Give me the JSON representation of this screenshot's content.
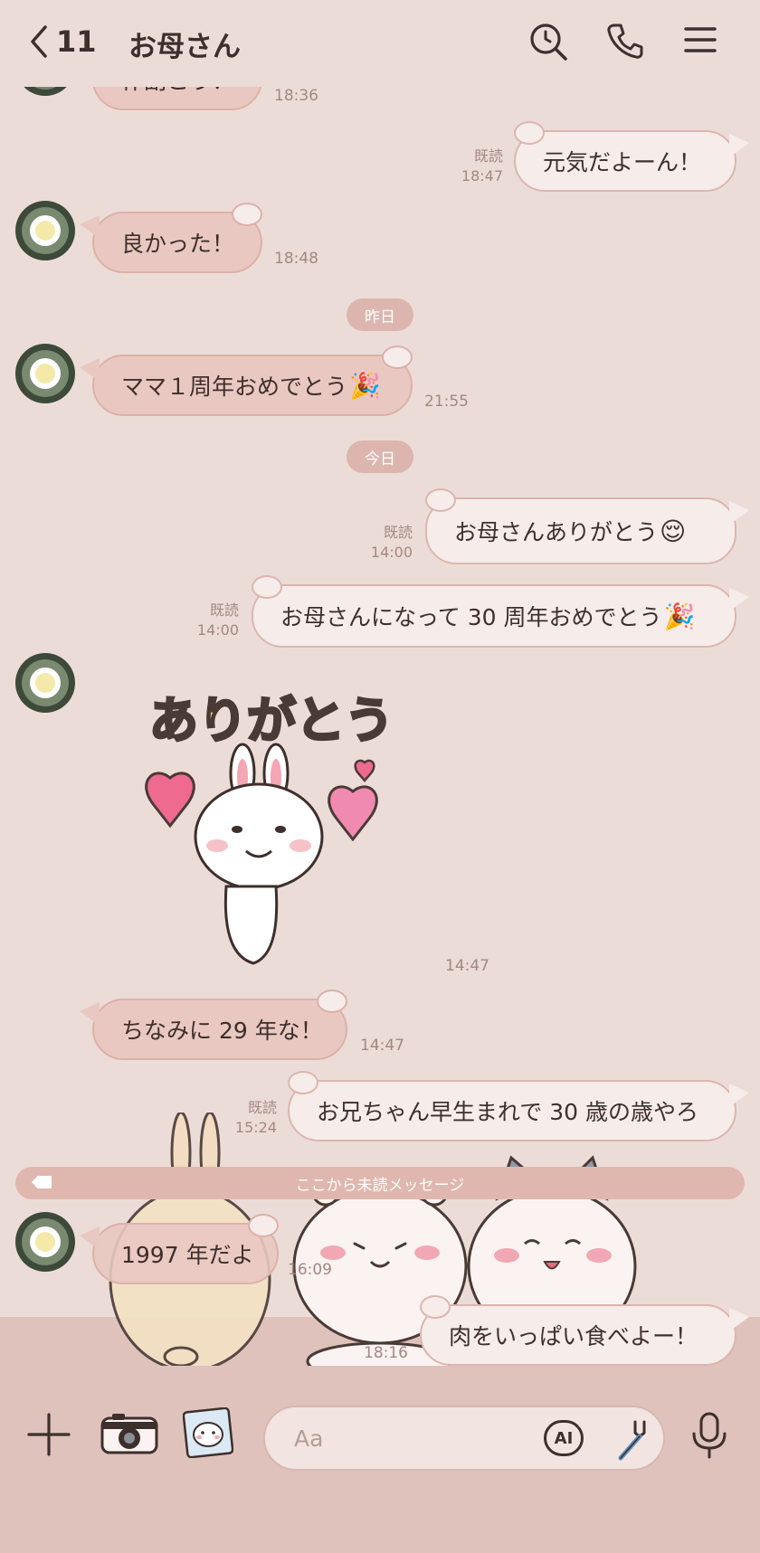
{
  "header": {
    "back_count": "11",
    "title": "お母さん"
  },
  "messages": [
    {
      "id": "m0",
      "dir": "in",
      "text": "作副こう！",
      "time": "18:36"
    },
    {
      "id": "m1",
      "dir": "out",
      "text": "元気だよーん！",
      "read": "既読",
      "time": "18:47"
    },
    {
      "id": "m2",
      "dir": "in",
      "text": "良かった！",
      "time": "18:48"
    },
    {
      "id": "m3",
      "dir": "in",
      "text": "ママ１周年おめでとう",
      "emoji": "🎉",
      "time": "21:55"
    },
    {
      "id": "m4",
      "dir": "out",
      "text": "お母さんありがとう",
      "emoji": "😌",
      "read": "既読",
      "time": "14:00"
    },
    {
      "id": "m5",
      "dir": "out",
      "text": "お母さんになって 30 周年おめでとう",
      "emoji": "🎉",
      "read": "既読",
      "time": "14:00"
    },
    {
      "id": "m6",
      "dir": "in",
      "sticker_text": "ありがとう",
      "time": "14:47"
    },
    {
      "id": "m7",
      "dir": "in",
      "text": "ちなみに 29 年な！",
      "time": "14:47"
    },
    {
      "id": "m8",
      "dir": "out",
      "text": "お兄ちゃん早生まれで 30 歳の歳やろ",
      "read": "既読",
      "time": "15:24"
    },
    {
      "id": "m9",
      "dir": "in",
      "text": "1997 年だよ",
      "time": "16:09"
    },
    {
      "id": "m10",
      "dir": "out",
      "text": "肉をいっぱい食べよー！",
      "time": "18:16"
    }
  ],
  "dates": {
    "yesterday": "昨日",
    "today": "今日"
  },
  "unread_divider": "ここから未読メッセージ",
  "input": {
    "placeholder": "Aa",
    "ai_label": "AI"
  },
  "icons": {
    "back": "chevron-left-icon",
    "search": "search-icon",
    "call": "phone-icon",
    "menu": "hamburger-menu-icon",
    "plus": "plus-icon",
    "camera": "camera-icon",
    "sticker": "sticker-icon",
    "ai": "ai-icon",
    "tuner": "tuning-fork-icon",
    "mic": "microphone-icon"
  },
  "colors": {
    "background": "#ecdcd8",
    "bubble_in": "#e9c8c1",
    "bubble_out": "#f6ecea",
    "accent": "#dcb6ae"
  }
}
